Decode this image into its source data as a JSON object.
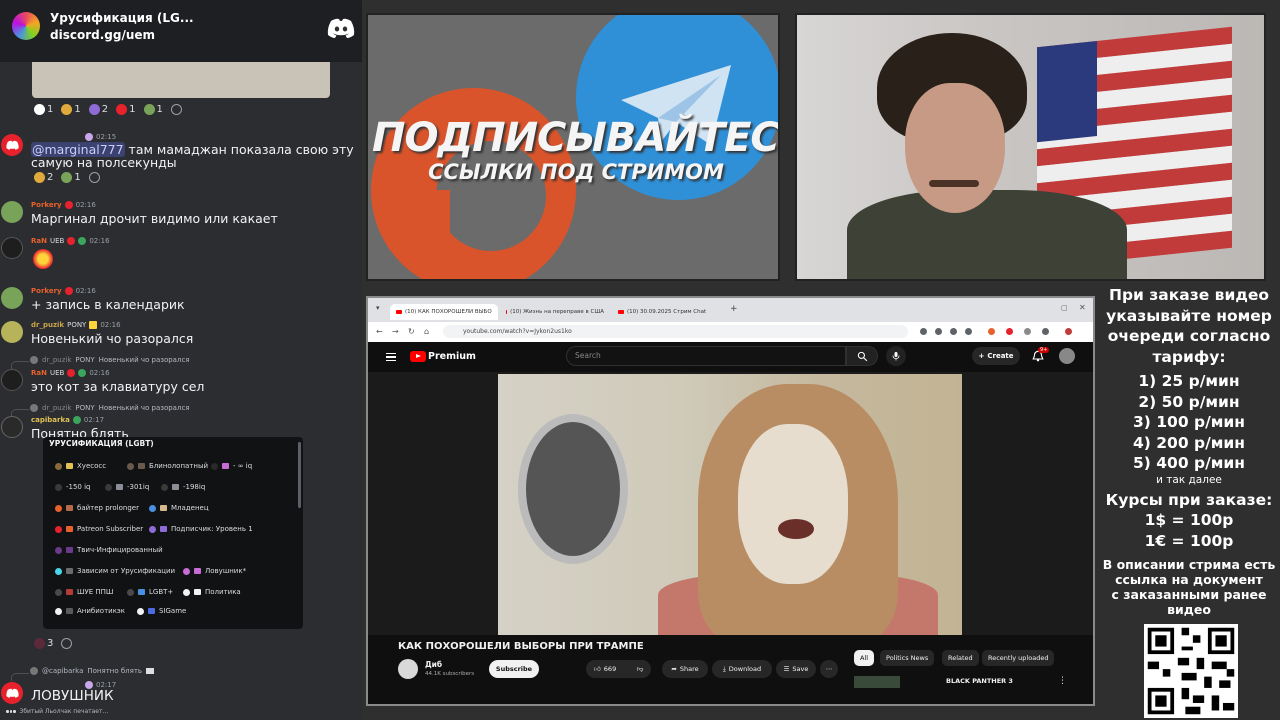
{
  "discord": {
    "server_name": "Урусификация (LG...",
    "invite": "discord.gg/uem",
    "reactions_top": [
      {
        "count": "1",
        "color": "#ffffff"
      },
      {
        "count": "1",
        "color": "#e0a93b"
      },
      {
        "count": "2",
        "color": "#8e6bd6"
      },
      {
        "count": "1",
        "color": "#e8222c"
      },
      {
        "count": "1",
        "color": "#7aa35a"
      }
    ],
    "messages": [
      {
        "user": "",
        "time": "02:15",
        "mention": "@marginal777",
        "text_line1": " там мамаджан показала свою эту",
        "text_line2": "самую на полсекунды"
      },
      {
        "user": "Porkery",
        "time": "02:16",
        "text": "Маргинал дрочит видимо или какает"
      },
      {
        "user": "RaN",
        "tag": "UEB",
        "time": "02:16",
        "text": ""
      },
      {
        "user": "Porkery",
        "time": "02:16",
        "text": "+ запись в календарик"
      },
      {
        "user": "dr_puzik",
        "tag": "PONY",
        "time": "02:16",
        "text": "Новенький чо разорался"
      },
      {
        "user": "RaN",
        "tag": "UEB",
        "time": "02:16",
        "text": "это кот за клавиатуру сел"
      },
      {
        "user": "capibarka",
        "time": "02:17",
        "text": "Понятно блять"
      },
      {
        "user": "",
        "time": "02:17",
        "text": "ЛОВУШНИК"
      }
    ],
    "reactions_mid": [
      {
        "count": "2"
      },
      {
        "count": "1"
      }
    ],
    "reply1": {
      "user": "dr_puzik",
      "tag": "PONY",
      "text": "Новенький чо разорался"
    },
    "reply2": {
      "user": "dr_puzik",
      "tag": "PONY",
      "text": "Новенький чо разорался"
    },
    "reply3": {
      "user": "@capibarka",
      "text": "Понятно блять"
    },
    "roles_title": "УРУСИФИКАЦИЯ (LGBT)",
    "roles": [
      "Хуесосс",
      "Блинолопатный",
      "- ∞ iq",
      "-150 iq",
      "-301iq",
      "-198iq",
      "байтер prolonger",
      "Младенец",
      "Patreon Subscriber",
      "Подписчик: Уровень 1",
      "Твич-Инфицированный",
      "Зависим от Урусификации",
      "Ловушник*",
      "ШУЕ ППШ",
      "LGBT+",
      "Политика",
      "Анибиотикэк",
      "SIGame"
    ],
    "roles_reaction": "3",
    "typing": "Збитый Льолчак печатает..."
  },
  "promo": {
    "title": "ПОДПИСЫВАЙТЕСЬ",
    "subtitle": "ССЫЛКИ ПОД СТРИМОМ"
  },
  "info": {
    "line1": "При заказе видео",
    "line2": "указывайте номер",
    "line3": "очереди согласно",
    "line4": "тарифу:",
    "tariffs": [
      "1) 25 р/мин",
      "2) 50 р/мин",
      "3) 100 р/мин",
      "4) 200 р/мин",
      "5) 400 р/мин"
    ],
    "etc": "и так далее",
    "rates_title": "Курсы при заказе:",
    "rate1": "1$ = 100р",
    "rate2": "1€ = 100р",
    "desc1": "В описании стрима есть",
    "desc2": "ссылка на документ",
    "desc3": "с заказанными ранее",
    "desc4": "видео"
  },
  "browser": {
    "tabs": [
      "(10) КАК ПОХОРОШЕЛИ ВЫБО",
      "(10) Жизнь на переправе в США",
      "(10) 30.09.2025 Стрим Chat"
    ],
    "url": "youtube.com/watch?v=Jykon2us1ko",
    "youtube": {
      "brand": "Premium",
      "search_placeholder": "Search",
      "create": "Create",
      "notifications": "9+",
      "video_title": "КАК ПОХОРОШЕЛИ ВЫБОРЫ ПРИ ТРАМПЕ",
      "channel": "Диб",
      "subscribers": "44.1K subscribers",
      "subscribe": "Subscribe",
      "likes": "669",
      "share": "Share",
      "download": "Download",
      "save": "Save",
      "chips": [
        "All",
        "Politics News",
        "Related",
        "Recently uploaded"
      ],
      "rec_title": "BLACK PANTHER 3"
    }
  }
}
